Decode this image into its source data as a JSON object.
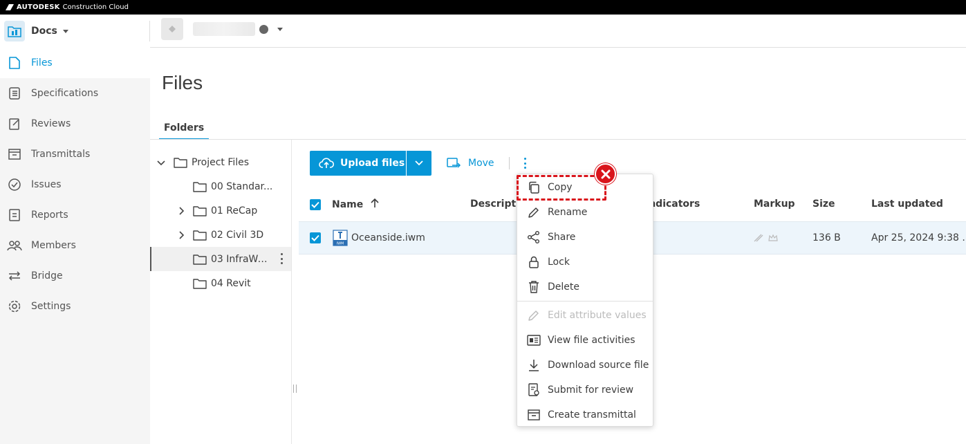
{
  "topbar": {
    "brand": "AUTODESK",
    "product": "Construction Cloud"
  },
  "docs": {
    "label": "Docs"
  },
  "nav": {
    "items": [
      {
        "label": "Files",
        "icon": "file-icon",
        "active": true
      },
      {
        "label": "Specifications",
        "icon": "specifications-icon"
      },
      {
        "label": "Reviews",
        "icon": "reviews-icon"
      },
      {
        "label": "Transmittals",
        "icon": "transmittals-icon"
      },
      {
        "label": "Issues",
        "icon": "issues-icon"
      },
      {
        "label": "Reports",
        "icon": "reports-icon"
      },
      {
        "label": "Members",
        "icon": "members-icon"
      },
      {
        "label": "Bridge",
        "icon": "bridge-icon"
      },
      {
        "label": "Settings",
        "icon": "settings-icon"
      }
    ]
  },
  "page": {
    "title": "Files",
    "tab": "Folders"
  },
  "tree": {
    "root": "Project Files",
    "children": [
      "00 Standar...",
      "01 ReCap",
      "02 Civil 3D",
      "03 InfraWo...",
      "04 Revit"
    ]
  },
  "toolbar": {
    "upload": "Upload files",
    "move": "Move"
  },
  "table": {
    "headers": {
      "name": "Name",
      "description": "Description",
      "indicators": "Indicators",
      "markup": "Markup",
      "size": "Size",
      "last_updated": "Last updated"
    },
    "rows": [
      {
        "name": "Oceanside.iwm",
        "size": "136 B",
        "last_updated": "Apr 25, 2024 9:38 ..."
      }
    ]
  },
  "menu": {
    "items": [
      {
        "label": "Copy",
        "icon": "copy-icon"
      },
      {
        "label": "Rename",
        "icon": "pencil-icon"
      },
      {
        "label": "Share",
        "icon": "share-icon"
      },
      {
        "label": "Lock",
        "icon": "lock-icon"
      },
      {
        "label": "Delete",
        "icon": "trash-icon"
      },
      {
        "label": "Edit attribute values",
        "icon": "pencil-icon",
        "disabled": true
      },
      {
        "label": "View file activities",
        "icon": "activities-icon"
      },
      {
        "label": "Download source file",
        "icon": "download-icon"
      },
      {
        "label": "Submit for review",
        "icon": "review-submit-icon"
      },
      {
        "label": "Create transmittal",
        "icon": "transmittal-icon"
      }
    ]
  },
  "colors": {
    "accent": "#0696d7",
    "error": "#d9141b",
    "selected_row": "#edf5fb"
  }
}
